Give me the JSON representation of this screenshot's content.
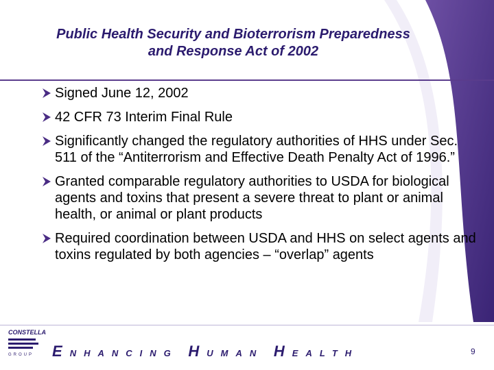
{
  "slide": {
    "title_line1": "Public Health Security and Bioterrorism Preparedness",
    "title_line2": "and Response Act of 2002",
    "bullets": [
      {
        "text": "Signed June 12, 2002"
      },
      {
        "text": "42 CFR 73 Interim Final Rule"
      },
      {
        "text": "Significantly changed the regulatory authorities of HHS under Sec. 511 of the “Antiterrorism and Effective Death Penalty Act of 1996.”"
      },
      {
        "text": "Granted comparable regulatory authorities to USDA for biological agents and toxins that present a severe threat to plant or animal health, or animal or plant products"
      },
      {
        "text": "Required coordination between USDA and HHS on select agents and toxins regulated by both agencies – “overlap” agents"
      }
    ],
    "bullet_icon": "arrow-bullet-icon",
    "page_number": "9"
  },
  "footer": {
    "logo_text": "CONSTELLA",
    "logo_subtext": "GROUP",
    "tagline_words": [
      {
        "cap": "E",
        "rest": "NHANCING"
      },
      {
        "cap": "H",
        "rest": "UMAN"
      },
      {
        "cap": "H",
        "rest": "EALTH"
      }
    ]
  },
  "colors": {
    "primary": "#2b1b6e",
    "accent": "#5a3c8c",
    "bullet_arrow": "#4a2c84"
  }
}
